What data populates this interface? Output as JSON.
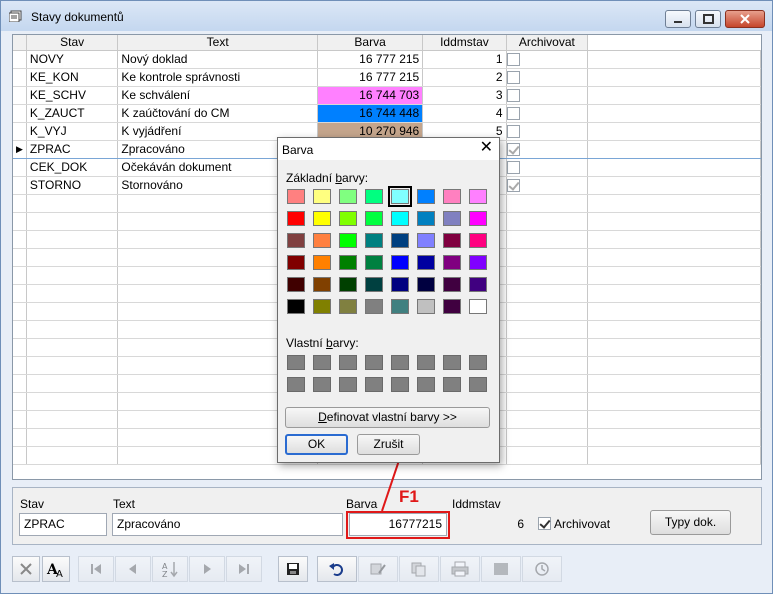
{
  "window": {
    "title": "Stavy dokumentů"
  },
  "grid": {
    "columns": [
      "Stav",
      "Text",
      "Barva",
      "Iddmstav",
      "Archivovat"
    ],
    "rows": [
      {
        "stav": "NOVY",
        "text": "Nový doklad",
        "barva": "16 777 215",
        "id": "1",
        "color": "#ffffff",
        "arch": false
      },
      {
        "stav": "KE_KON",
        "text": "Ke kontrole správnosti",
        "barva": "16 777 215",
        "id": "2",
        "color": "#ffffff",
        "arch": false
      },
      {
        "stav": "KE_SCHV",
        "text": "Ke schválení",
        "barva": "16 744 703",
        "id": "3",
        "color": "#ff80ff",
        "arch": false
      },
      {
        "stav": "K_ZAUCT",
        "text": "K zaúčtování do CM",
        "barva": "16 744 448",
        "id": "4",
        "color": "#0080ff",
        "arch": false
      },
      {
        "stav": "K_VYJ",
        "text": "K vyjádření",
        "barva": "10 270 946",
        "id": "5",
        "color": "#c4a58c",
        "arch": false
      },
      {
        "stav": "ZPRAC",
        "text": "Zpracováno",
        "barva": "",
        "id": "",
        "color": "#ffffff",
        "arch": true
      },
      {
        "stav": "CEK_DOK",
        "text": "Očekáván dokument",
        "barva": "",
        "id": "",
        "color": "#ffffff",
        "arch": false
      },
      {
        "stav": "STORNO",
        "text": "Stornováno",
        "barva": "",
        "id": "",
        "color": "#ffffff",
        "arch": true
      }
    ],
    "selected_index": 5
  },
  "edit": {
    "stav_label": "Stav",
    "stav_value": "ZPRAC",
    "text_label": "Text",
    "text_value": "Zpracováno",
    "barva_label": "Barva",
    "barva_value": "16777215",
    "id_label": "Iddmstav",
    "id_value": "6",
    "archivovat_label": "Archivovat",
    "archivovat_checked": true,
    "typy_button": "Typy dok."
  },
  "annotation": {
    "label": "F1",
    "color": "#e01818"
  },
  "dialog": {
    "title": "Barva",
    "basic_label_pre": "Základní ",
    "basic_label_u": "b",
    "basic_label_post": "arvy:",
    "custom_label_pre": "Vlastní ",
    "custom_label_u": "b",
    "custom_label_post": "arvy:",
    "define_pre": "",
    "define_u": "D",
    "define_post": "efinovat vlastní barvy >>",
    "ok": "OK",
    "cancel": "Zrušit",
    "basic_colors": [
      "#ff8080",
      "#ffff80",
      "#80ff80",
      "#00ff80",
      "#80ffff",
      "#0080ff",
      "#ff80c0",
      "#ff80ff",
      "#ff0000",
      "#ffff00",
      "#80ff00",
      "#00ff40",
      "#00ffff",
      "#0080c0",
      "#8080c0",
      "#ff00ff",
      "#804040",
      "#ff8040",
      "#00ff00",
      "#008080",
      "#004080",
      "#8080ff",
      "#800040",
      "#ff0080",
      "#800000",
      "#ff8000",
      "#008000",
      "#008040",
      "#0000ff",
      "#0000a0",
      "#800080",
      "#8000ff",
      "#400000",
      "#804000",
      "#004000",
      "#004040",
      "#000080",
      "#000040",
      "#400040",
      "#400080",
      "#000000",
      "#808000",
      "#808040",
      "#808080",
      "#408080",
      "#c0c0c0",
      "#400040",
      "#ffffff"
    ],
    "selected_basic": 4
  },
  "toolbar": {
    "icons": [
      "close-icon",
      "font-icon",
      "first-record-icon",
      "prev-record-icon",
      "sort-icon",
      "next-record-icon",
      "last-record-icon",
      "save-icon",
      "undo-icon",
      "edit-icon",
      "copy-icon",
      "print-icon",
      "stop-icon",
      "clock-icon"
    ]
  }
}
